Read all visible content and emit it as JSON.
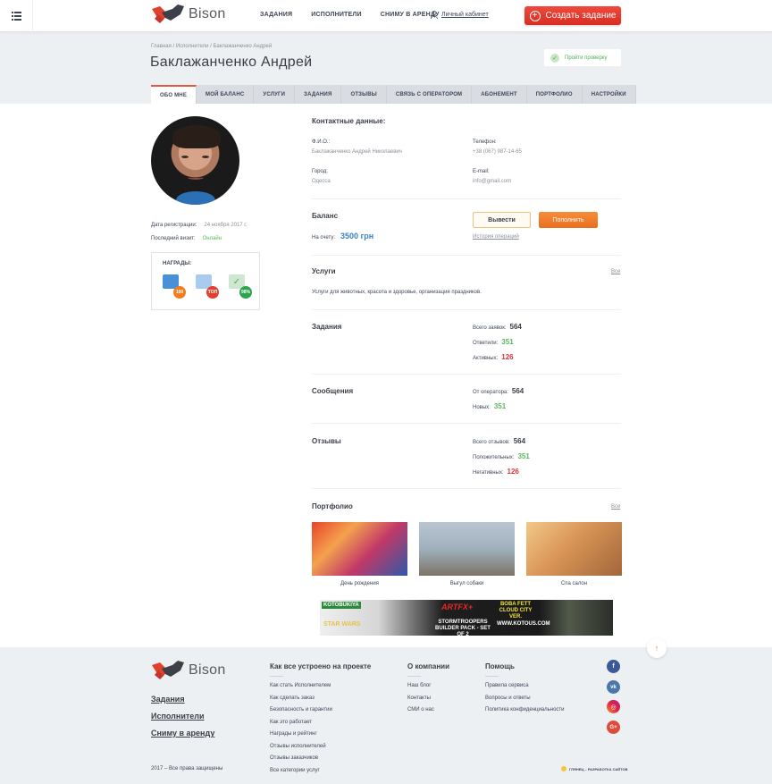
{
  "header": {
    "logo_text": "Bison",
    "nav": [
      "ЗАДАНИЯ",
      "ИСПОЛНИТЕЛИ",
      "СНИМУ В АРЕНДУ"
    ],
    "cabinet_label": "Личный кабинет",
    "create_button": "Создать задание"
  },
  "breadcrumb": "Главная / Исполнители / Баклажанченко Андрей",
  "page_title": "Баклажанченко Андрей",
  "verify_button": "Пройти проверку",
  "tabs": [
    {
      "label": "ОБО МНЕ",
      "active": true
    },
    {
      "label": "МОЙ БАЛАНС"
    },
    {
      "label": "УСЛУГИ"
    },
    {
      "label": "ЗАДАНИЯ"
    },
    {
      "label": "ОТЗЫВЫ"
    },
    {
      "label": "СВЯЗЬ С ОПЕРАТОРОМ"
    },
    {
      "label": "АБОНЕМЕНТ"
    },
    {
      "label": "ПОРТФОЛИО"
    },
    {
      "label": "НАСТРОЙКИ"
    }
  ],
  "profile": {
    "reg_label": "Дата регистрации:",
    "reg_value": "24 ноября 2017 г.",
    "visit_label": "Последний визит:",
    "visit_value": "Онлайн",
    "awards_title": "НАГРАДЫ:",
    "awards": [
      {
        "icon": "document-icon",
        "badge": "100",
        "color": "#f07d1e"
      },
      {
        "icon": "user-card-icon",
        "badge": "ТОП",
        "color": "#e0412f"
      },
      {
        "icon": "check-icon",
        "badge": "98%",
        "color": "#2ea44f"
      }
    ]
  },
  "contacts": {
    "title": "Контактные данные:",
    "fio_label": "Ф.И.О.:",
    "fio_value": "Баклажанченко Андрей Николаевич",
    "phone_label": "Телефон:",
    "phone_value": "+38 (067) 987-14-65",
    "city_label": "Город:",
    "city_value": "Одесса",
    "email_label": "E-mail:",
    "email_value": "info@gmail.com"
  },
  "balance": {
    "title": "Баланс",
    "account_label": "На счету:",
    "amount": "3500 грн",
    "withdraw_button": "Вывести",
    "topup_button": "Пополнить",
    "history_link": "История операций"
  },
  "services": {
    "title": "Услуги",
    "all_link": "Все",
    "text": "Услуги для животных, красота и здоровье, организация праздников."
  },
  "tasks": {
    "title": "Задания",
    "stats": [
      {
        "label": "Всего заявок:",
        "value": "564",
        "tone": "dark"
      },
      {
        "label": "Ответили:",
        "value": "351",
        "tone": "green"
      },
      {
        "label": "Активных:",
        "value": "126",
        "tone": "red"
      }
    ]
  },
  "messages": {
    "title": "Сообщения",
    "stats": [
      {
        "label": "От оператора:",
        "value": "564",
        "tone": "dark"
      },
      {
        "label": "Новых:",
        "value": "351",
        "tone": "green"
      }
    ]
  },
  "reviews": {
    "title": "Отзывы",
    "stats": [
      {
        "label": "Всего отзывов:",
        "value": "564",
        "tone": "dark"
      },
      {
        "label": "Положительных:",
        "value": "351",
        "tone": "green"
      },
      {
        "label": "Негативных:",
        "value": "126",
        "tone": "red"
      }
    ]
  },
  "portfolio": {
    "title": "Портфолио",
    "all_link": "Все",
    "items": [
      {
        "caption": "День рождения"
      },
      {
        "caption": "Выгул собаки"
      },
      {
        "caption": "Спа салон"
      }
    ]
  },
  "ad": {
    "brand": "KOTOBUKIYA",
    "logo": "STAR WARS",
    "artfx": "ARTFX+",
    "boba": "BOBA FETT CLOUD CITY VER.",
    "product": "STORMTROOPERS BUILDER PACK - SET OF 2",
    "url": "WWW.KOTOUS.COM"
  },
  "footer": {
    "logo_text": "Bison",
    "main_links": [
      "Задания",
      "Исполнители",
      "Сниму в аренду"
    ],
    "copyright": "2017 – Все права защищены",
    "columns": [
      {
        "title": "Как все устроено на проекте",
        "links": [
          "Как стать Исполнителем",
          "Как сделать заказ",
          "Безопасность и гарантии",
          "Как это работает",
          "Награды и рейтинг",
          "Отзывы исполнителей",
          "Отзывы заказчиков",
          "Все категории услуг"
        ]
      },
      {
        "title": "О компании",
        "links": [
          "Наш блог",
          "Контакты",
          "СМИ о нас"
        ]
      },
      {
        "title": "Помощь",
        "links": [
          "Правила сервиса",
          "Вопросы и ответы",
          "Политика конфиденциальности"
        ]
      }
    ],
    "social": [
      {
        "name": "facebook",
        "glyph": "f",
        "color": "#3b5998"
      },
      {
        "name": "vk",
        "glyph": "vk",
        "color": "#4a76a8"
      },
      {
        "name": "instagram",
        "glyph": "◎",
        "color": "#c13584"
      },
      {
        "name": "google-plus",
        "glyph": "G+",
        "color": "#dd4b39"
      }
    ],
    "dev_credit": "ГЛЯНЕЦ – РАЗРАБОТКА САЙТОВ"
  }
}
